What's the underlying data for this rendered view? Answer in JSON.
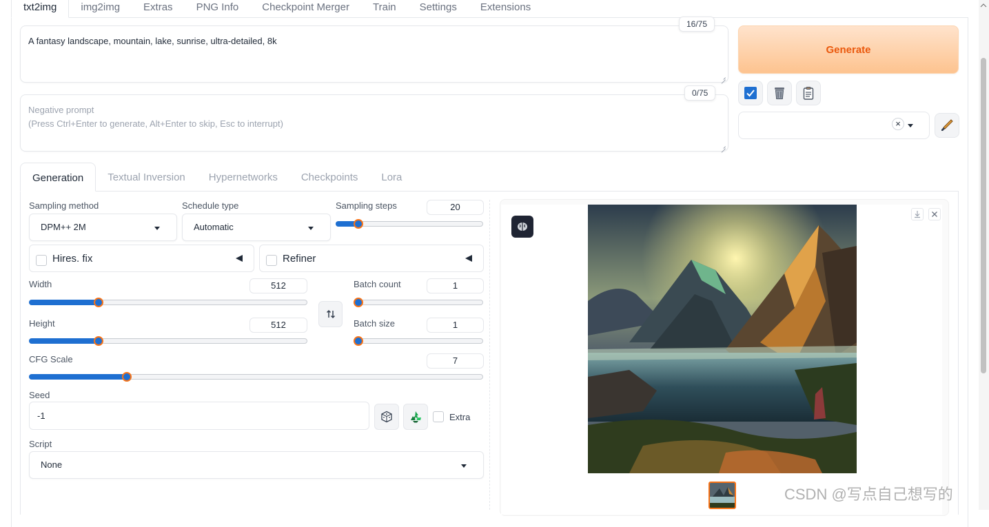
{
  "top_tabs": [
    "txt2img",
    "img2img",
    "Extras",
    "PNG Info",
    "Checkpoint Merger",
    "Train",
    "Settings",
    "Extensions"
  ],
  "prompt": {
    "value": "A fantasy landscape, mountain, lake, sunrise, ultra-detailed, 8k",
    "token_count": "16/75"
  },
  "negative_prompt": {
    "placeholder": "Negative prompt\n(Press Ctrl+Enter to generate, Alt+Enter to skip, Esc to interrupt)",
    "token_count": "0/75"
  },
  "actions": {
    "generate_label": "Generate",
    "clear_icon": "×"
  },
  "sub_tabs": [
    "Generation",
    "Textual Inversion",
    "Hypernetworks",
    "Checkpoints",
    "Lora"
  ],
  "generation": {
    "sampling_method_label": "Sampling method",
    "sampling_method_value": "DPM++ 2M",
    "schedule_type_label": "Schedule type",
    "schedule_type_value": "Automatic",
    "sampling_steps_label": "Sampling steps",
    "sampling_steps_value": "20",
    "sampling_steps_fraction": 0.13,
    "hires_fix_label": "Hires. fix",
    "refiner_label": "Refiner",
    "width_label": "Width",
    "width_value": "512",
    "width_fraction": 0.24,
    "height_label": "Height",
    "height_value": "512",
    "height_fraction": 0.24,
    "batch_count_label": "Batch count",
    "batch_count_value": "1",
    "batch_count_fraction": 0.0,
    "batch_size_label": "Batch size",
    "batch_size_value": "1",
    "batch_size_fraction": 0.0,
    "cfg_scale_label": "CFG Scale",
    "cfg_scale_value": "7",
    "cfg_scale_fraction": 0.21,
    "seed_label": "Seed",
    "seed_value": "-1",
    "extra_label": "Extra",
    "script_label": "Script",
    "script_value": "None"
  },
  "watermark": "CSDN @写点自己想写的",
  "colors": {
    "accent": "#1e6fd1",
    "generate_text": "#ea580c",
    "generate_bg": "#fdc38f",
    "thumb_border": "#f97316"
  }
}
